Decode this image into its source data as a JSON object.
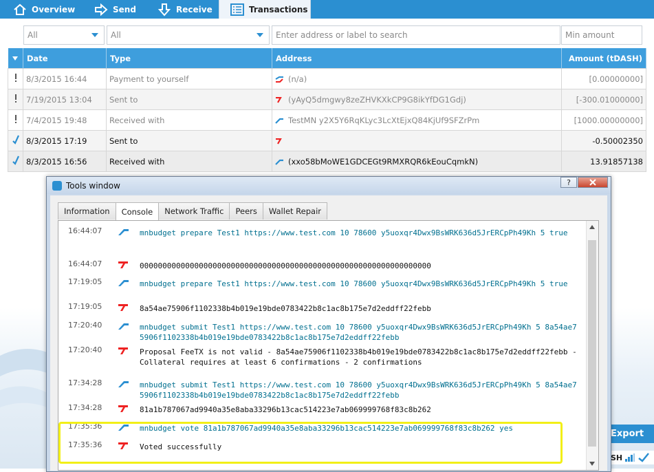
{
  "nav": {
    "tabs": [
      {
        "label": "Overview",
        "icon": "home-icon",
        "active": false
      },
      {
        "label": "Send",
        "icon": "send-arrow-icon",
        "active": false
      },
      {
        "label": "Receive",
        "icon": "receive-arrow-icon",
        "active": false
      },
      {
        "label": "Transactions",
        "icon": "list-icon",
        "active": true
      }
    ]
  },
  "filters": {
    "date": "All",
    "type": "All",
    "search_placeholder": "Enter address or label to search",
    "min_amount_placeholder": "Min amount"
  },
  "table": {
    "headers": [
      "Date",
      "Type",
      "Address",
      "Amount (tDASH)"
    ],
    "rows": [
      {
        "status": "unconfirmed",
        "date": "8/3/2015 16:44",
        "type": "Payment to yourself",
        "direction": "both",
        "address": "(n/a)",
        "amount": "[0.00000000]"
      },
      {
        "status": "unconfirmed",
        "date": "7/19/2015 13:04",
        "type": "Sent to",
        "direction": "out",
        "address": "(yAyQ5dmgwy8zeZHVKXkCP9G8ikYfDG1Gdj)",
        "amount": "[-300.01000000]"
      },
      {
        "status": "unconfirmed",
        "date": "7/4/2015 19:48",
        "type": "Received with",
        "direction": "in",
        "address": "TestMN y2X5Y6RqKLyc3LcXtEjxQ84KjUf9SFZrPm",
        "amount": "[1000.00000000]"
      },
      {
        "status": "confirmed",
        "date": "8/3/2015 17:19",
        "type": "Sent to",
        "direction": "out",
        "address": "",
        "amount": "-0.50002350"
      },
      {
        "status": "confirmed",
        "date": "8/3/2015 16:56",
        "type": "Received with",
        "direction": "in",
        "address": "(xxo58bMoWE1GDCEGt9RMXRQR6kEouCqmkN)",
        "amount": "13.91857138"
      }
    ]
  },
  "export_label": "Export",
  "status_fragment": "SH",
  "tools_window": {
    "title": "Tools window",
    "help_label": "?",
    "tabs": [
      "Information",
      "Console",
      "Network Traffic",
      "Peers",
      "Wallet Repair"
    ],
    "active_tab": "Console",
    "console": [
      {
        "time": "16:44:07",
        "dir": "cmd",
        "text": "mnbudget prepare Test1 https://www.test.com 10 78600 y5uoxqr4Dwx9BsWRK636d5JrERCpPh49Kh 5 true"
      },
      {
        "time": "16:44:07",
        "dir": "reply",
        "text": "0000000000000000000000000000000000000000000000000000000000000000"
      },
      {
        "time": "17:19:05",
        "dir": "cmd",
        "text": "mnbudget prepare Test1 https://www.test.com 10 78600 y5uoxqr4Dwx9BsWRK636d5JrERCpPh49Kh 5 true"
      },
      {
        "time": "17:19:05",
        "dir": "reply",
        "text": "8a54ae75906f1102338b4b019e19bde0783422b8c1ac8b175e7d2eddff22febb"
      },
      {
        "time": "17:20:40",
        "dir": "cmd",
        "text": "mnbudget submit Test1 https://www.test.com 10 78600 y5uoxqr4Dwx9BsWRK636d5JrERCpPh49Kh 5 8a54ae75906f1102338b4b019e19bde0783422b8c1ac8b175e7d2eddff22febb"
      },
      {
        "time": "17:20:40",
        "dir": "reply",
        "text": "Proposal FeeTX is not valid - 8a54ae75906f1102338b4b019e19bde0783422b8c1ac8b175e7d2eddff22febb - Collateral requires at least 6 confirmations - 2 confirmations"
      },
      {
        "time": "17:34:28",
        "dir": "cmd",
        "text": "mnbudget submit Test1 https://www.test.com 10 78600 y5uoxqr4Dwx9BsWRK636d5JrERCpPh49Kh 5 8a54ae75906f1102338b4b019e19bde0783422b8c1ac8b175e7d2eddff22febb"
      },
      {
        "time": "17:34:28",
        "dir": "reply",
        "text": "81a1b787067ad9940a35e8aba33296b13cac514223e7ab069999768f83c8b262"
      },
      {
        "time": "17:35:36",
        "dir": "cmd",
        "text": "mnbudget vote 81a1b787067ad9940a35e8aba33296b13cac514223e7ab069999768f83c8b262 yes"
      },
      {
        "time": "17:35:36",
        "dir": "reply",
        "text": "Voted successfully"
      }
    ]
  },
  "colors": {
    "accent": "#2b8fd1",
    "header": "#3e9edd",
    "negative": "#d01f1f",
    "command": "#006f8f",
    "highlight": "#f2ef17"
  }
}
